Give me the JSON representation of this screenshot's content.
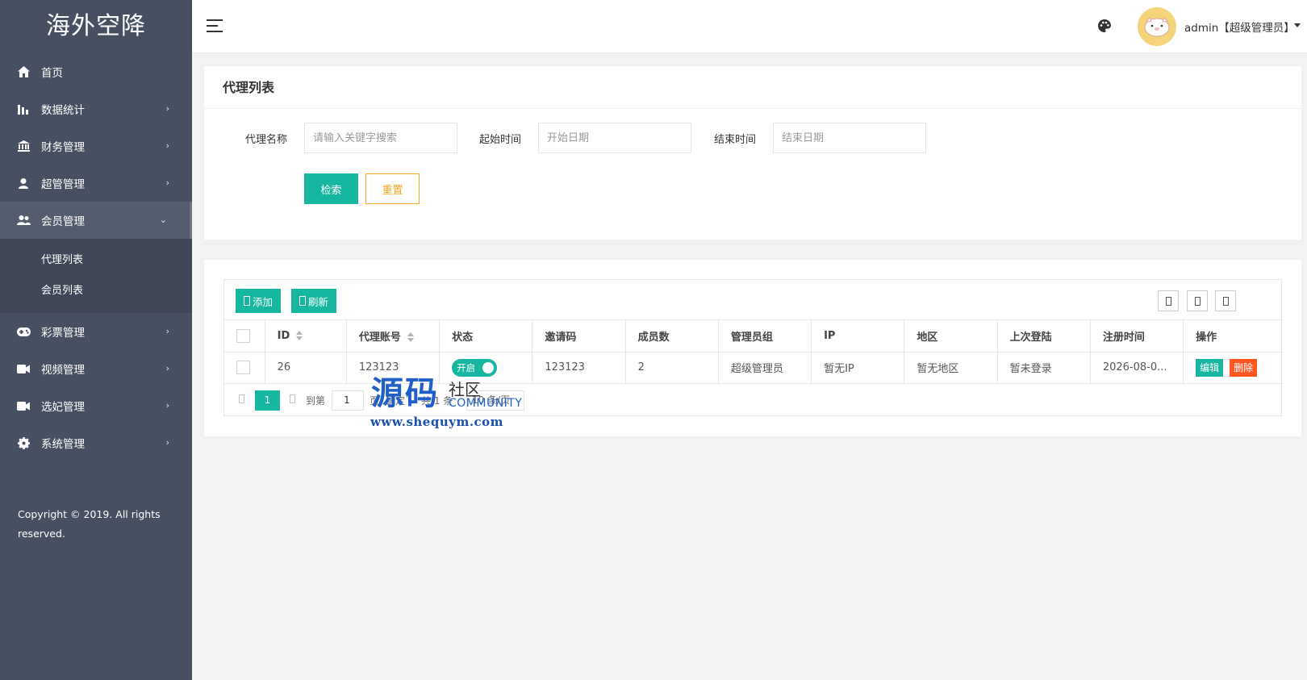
{
  "brand": "海外空降",
  "sidebar": {
    "items": [
      {
        "label": "首页",
        "icon": "home-icon",
        "has_arrow": false
      },
      {
        "label": "数据统计",
        "icon": "bar-chart-icon",
        "has_arrow": true
      },
      {
        "label": "财务管理",
        "icon": "bank-icon",
        "has_arrow": true
      },
      {
        "label": "超管管理",
        "icon": "user-icon",
        "has_arrow": true
      },
      {
        "label": "会员管理",
        "icon": "users-icon",
        "has_arrow": true,
        "expanded": true
      },
      {
        "label": "彩票管理",
        "icon": "gamepad-icon",
        "has_arrow": true
      },
      {
        "label": "视频管理",
        "icon": "video-icon",
        "has_arrow": true
      },
      {
        "label": "选妃管理",
        "icon": "video-icon",
        "has_arrow": true
      },
      {
        "label": "系统管理",
        "icon": "gear-icon",
        "has_arrow": true
      }
    ],
    "subitems": [
      {
        "label": "代理列表"
      },
      {
        "label": "会员列表"
      }
    ],
    "copyright": "Copyright © 2019. All rights reserved."
  },
  "header": {
    "user": "admin【超级管理员】"
  },
  "search": {
    "title": "代理列表",
    "name_label": "代理名称",
    "name_placeholder": "请输入关键字搜索",
    "start_label": "起始时间",
    "start_placeholder": "开始日期",
    "end_label": "结束时间",
    "end_placeholder": "结束日期",
    "search_button": "检索",
    "reset_button": "重置"
  },
  "table": {
    "add_button": "添加",
    "refresh_button": "刷新",
    "columns": [
      "ID",
      "代理账号",
      "状态",
      "邀请码",
      "成员数",
      "管理员组",
      "IP",
      "地区",
      "上次登陆",
      "注册时间",
      "操作"
    ],
    "rows": [
      {
        "id": "26",
        "account": "123123",
        "status": "开启",
        "invite_code": "123123",
        "members": "2",
        "group": "超级管理员",
        "ip": "暂无IP",
        "region": "暂无地区",
        "last_login": "暂未登录",
        "registered": "2026-08-0...",
        "edit": "编辑",
        "delete": "删除"
      }
    ]
  },
  "pager": {
    "current": "1",
    "goto_label": "到第",
    "goto_value": "1",
    "page_suffix": "页",
    "confirm": "确定",
    "total": "共 1 条",
    "per_page": "10 条/页"
  },
  "watermark": {
    "big": "源码",
    "small": "社区",
    "community": "COMMUNITY",
    "url": "www.shequym.com"
  },
  "colors": {
    "sidebar": "#475062",
    "accent": "#16b6a0",
    "warning": "#f5a623",
    "danger": "#ff5722"
  }
}
